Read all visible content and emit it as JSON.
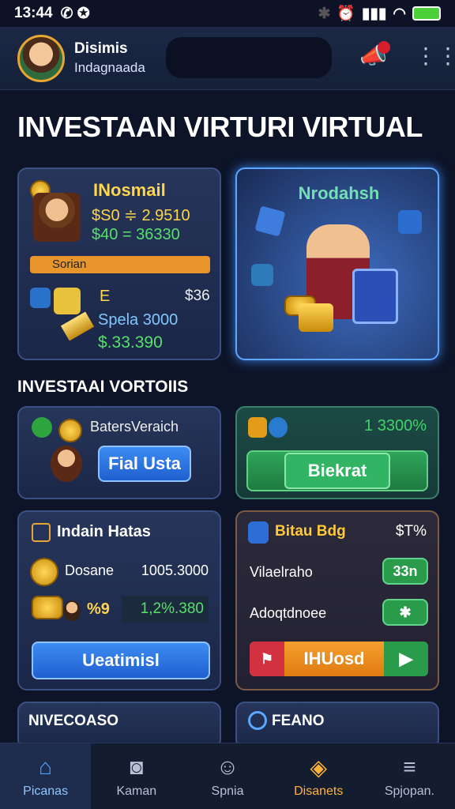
{
  "status": {
    "time": "13:44",
    "icons": "✆ ✪"
  },
  "header": {
    "name": "Disimis",
    "handle": "Indagnaada",
    "bell": "📣",
    "menu": "⋮⋮"
  },
  "page_title": "INVESTAAN VIRTURI VIRTUAL",
  "card1": {
    "title": "INosmail",
    "line1": "$S0 ≑ 2.9510",
    "line2": "$40 = 36330",
    "bar": "Sorian",
    "label_e": "E",
    "value_r": "$36",
    "label_s": "Spela 3000",
    "amount": "$.33.390"
  },
  "card2": {
    "title": "Nrodahsh"
  },
  "section2": "INVESTAAI VORTOIIS",
  "card3": {
    "title": "BatersVeraich",
    "button": "Fial Usta"
  },
  "card4": {
    "value": "1 3300%",
    "button": "Biekrat"
  },
  "card5": {
    "title": "Indain Hatas",
    "row1_label": "Dosane",
    "row1_value": "1005.3000",
    "row2_value": "1,2%.380",
    "row2_tag": "%9",
    "button": "Ueatimisl"
  },
  "card6": {
    "title": "Bitau Bdg",
    "pct": "$T%",
    "row1_label": "Vilaelraho",
    "row1_btn": "33n",
    "row2_label": "Adoqtdnoee",
    "row2_btn": "✱",
    "big_button": "IHUosd"
  },
  "card7": {
    "title": "NIVECOASO"
  },
  "card8": {
    "title": "FEANO"
  },
  "nav": [
    {
      "label": "Picanas",
      "icon": "⌂"
    },
    {
      "label": "Kaman",
      "icon": "◙"
    },
    {
      "label": "Spnia",
      "icon": "☺"
    },
    {
      "label": "Disanets",
      "icon": "◈"
    },
    {
      "label": "Spjopan.",
      "icon": "≡"
    }
  ]
}
